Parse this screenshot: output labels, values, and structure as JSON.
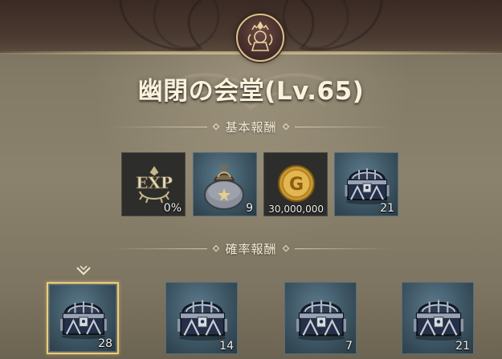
{
  "dungeon": {
    "title": "幽閉の会堂(Lv.65)"
  },
  "sections": {
    "basic": "基本報酬",
    "probability": "確率報酬"
  },
  "basic_rewards": [
    {
      "icon": "exp-badge-icon",
      "count": "0%"
    },
    {
      "icon": "item-pouch-icon",
      "count": "9"
    },
    {
      "icon": "gold-coin-icon",
      "count": "30,000,000"
    },
    {
      "icon": "treasure-chest-icon",
      "count": "21"
    }
  ],
  "probability_rewards": [
    {
      "icon": "treasure-chest-icon",
      "count": "28",
      "selected": true
    },
    {
      "icon": "treasure-chest-icon",
      "count": "14",
      "selected": false
    },
    {
      "icon": "treasure-chest-icon",
      "count": "7",
      "selected": false
    },
    {
      "icon": "treasure-chest-icon",
      "count": "21",
      "selected": false
    }
  ],
  "colors": {
    "selection": "#e8cf7c",
    "title_text": "#fbf1dc"
  }
}
